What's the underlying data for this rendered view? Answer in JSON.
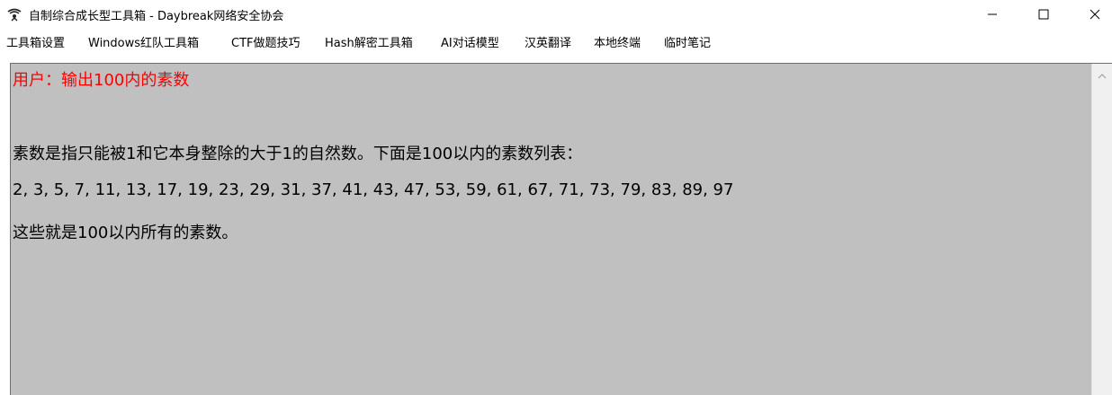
{
  "window": {
    "title": "自制综合成长型工具箱 - Daybreak网络安全协会",
    "app_icon": "app-logo-icon",
    "controls": [
      "minimize-icon",
      "maximize-icon",
      "close-icon"
    ]
  },
  "menu": {
    "items": [
      {
        "label": "工具箱设置"
      },
      {
        "label": "Windows红队工具箱"
      },
      {
        "label": "CTF做题技巧"
      },
      {
        "label": "Hash解密工具箱"
      },
      {
        "label": "AI对话模型"
      },
      {
        "label": "汉英翻译"
      },
      {
        "label": "本地终端"
      },
      {
        "label": "临时笔记"
      }
    ]
  },
  "chat": {
    "user_line": "用户：输出100内的素数",
    "reply_intro": "素数是指只能被1和它本身整除的大于1的自然数。下面是100以内的素数列表：",
    "prime_list": "2, 3, 5, 7, 11, 13, 17, 19, 23, 29, 31, 37, 41, 43, 47, 53, 59, 61, 67, 71, 73, 79, 83, 89, 97",
    "reply_outro": "这些就是100以内所有的素数。"
  },
  "colors": {
    "text_area_bg": "#c0c0c0",
    "user_text": "#ff0000",
    "reply_text": "#000000"
  }
}
